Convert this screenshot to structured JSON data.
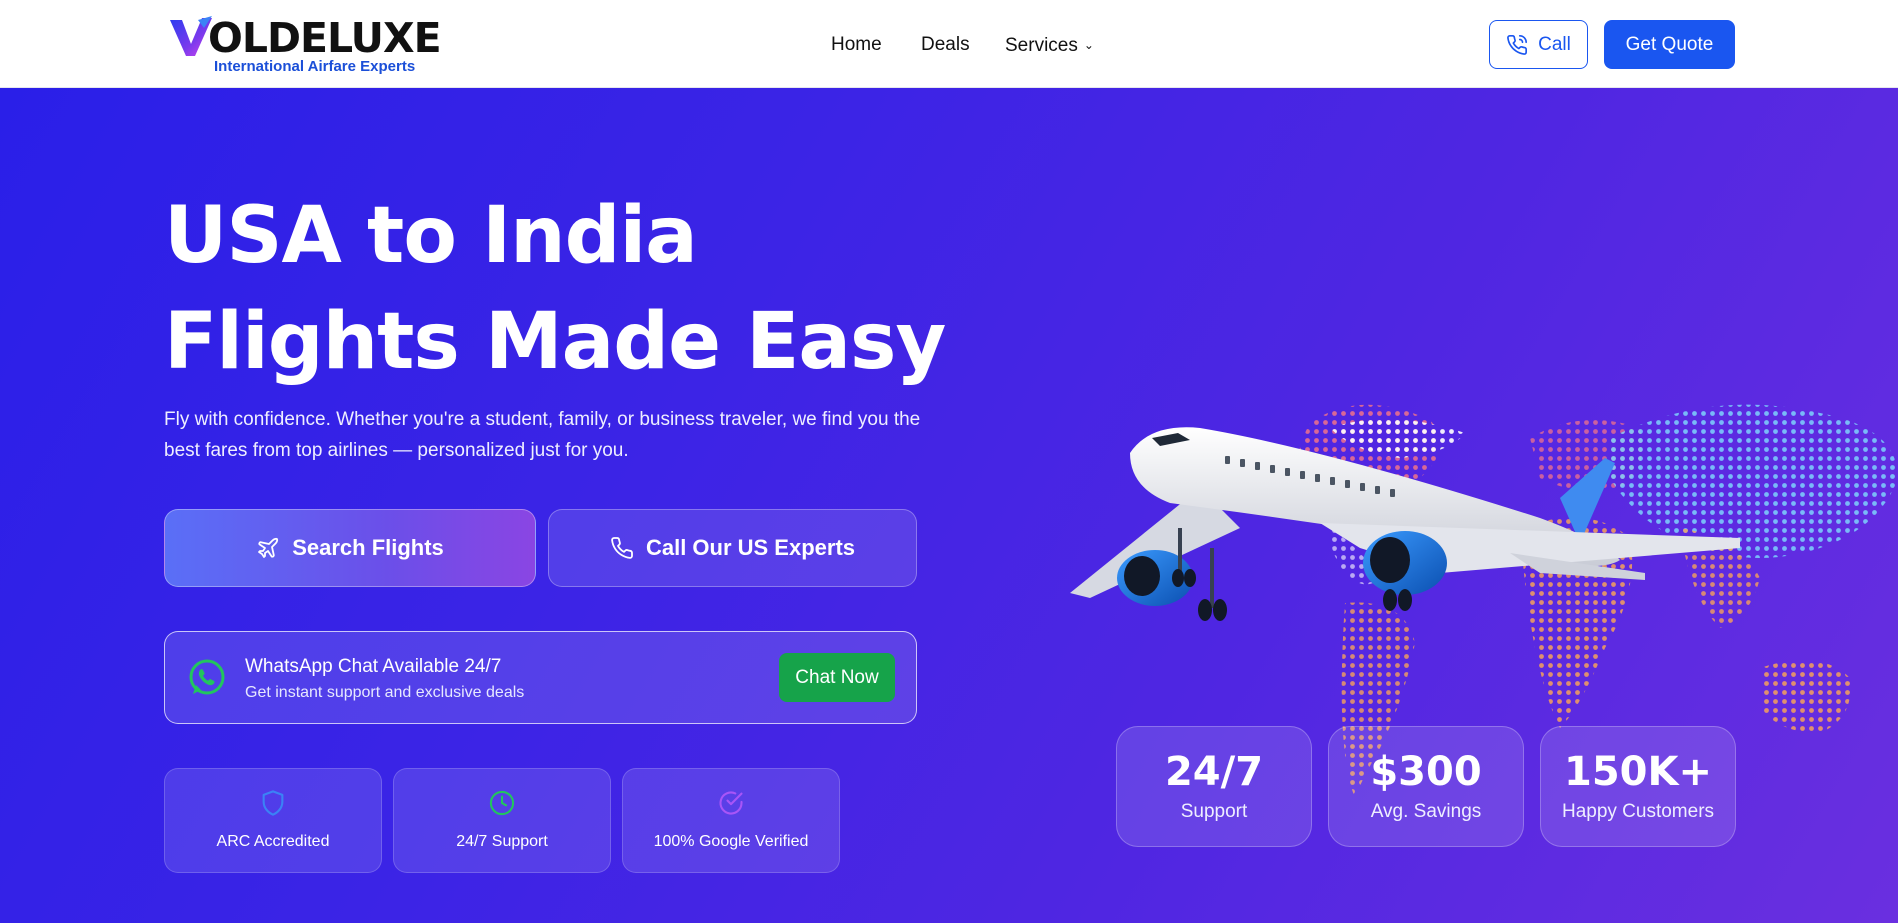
{
  "header": {
    "logo": {
      "wordmark": "OLDELUXE",
      "tagline": "International Airfare Experts"
    },
    "nav": [
      {
        "label": "Home"
      },
      {
        "label": "Deals"
      },
      {
        "label": "Services"
      }
    ],
    "call_label": "Call",
    "quote_label": "Get Quote"
  },
  "hero": {
    "title_line1": "USA to India",
    "title_line2": "Flights Made Easy",
    "subtitle": "Fly with confidence. Whether you're a student, family, or business traveler, we find you the best fares from top airlines — personalized just for you.",
    "search_label": "Search Flights",
    "experts_label": "Call Our US Experts",
    "whatsapp": {
      "title": "WhatsApp Chat Available 24/7",
      "subtitle": "Get instant support and exclusive deals",
      "button": "Chat Now"
    },
    "badges": [
      {
        "label": "ARC Accredited",
        "icon": "shield-icon",
        "color": "#3b82f6"
      },
      {
        "label": "24/7 Support",
        "icon": "clock-icon",
        "color": "#22c55e"
      },
      {
        "label": "100% Google Verified",
        "icon": "check-circle-icon",
        "color": "#a855f7"
      }
    ],
    "stats": [
      {
        "value": "24/7",
        "label": "Support"
      },
      {
        "value": "$300",
        "label": "Avg. Savings"
      },
      {
        "value": "150K+",
        "label": "Happy Customers"
      }
    ]
  },
  "colors": {
    "brand_blue": "#1a56f0",
    "whatsapp_green": "#16a34a",
    "hero_gradient_start": "#2a1fe8",
    "hero_gradient_end": "#6a2fe0"
  }
}
